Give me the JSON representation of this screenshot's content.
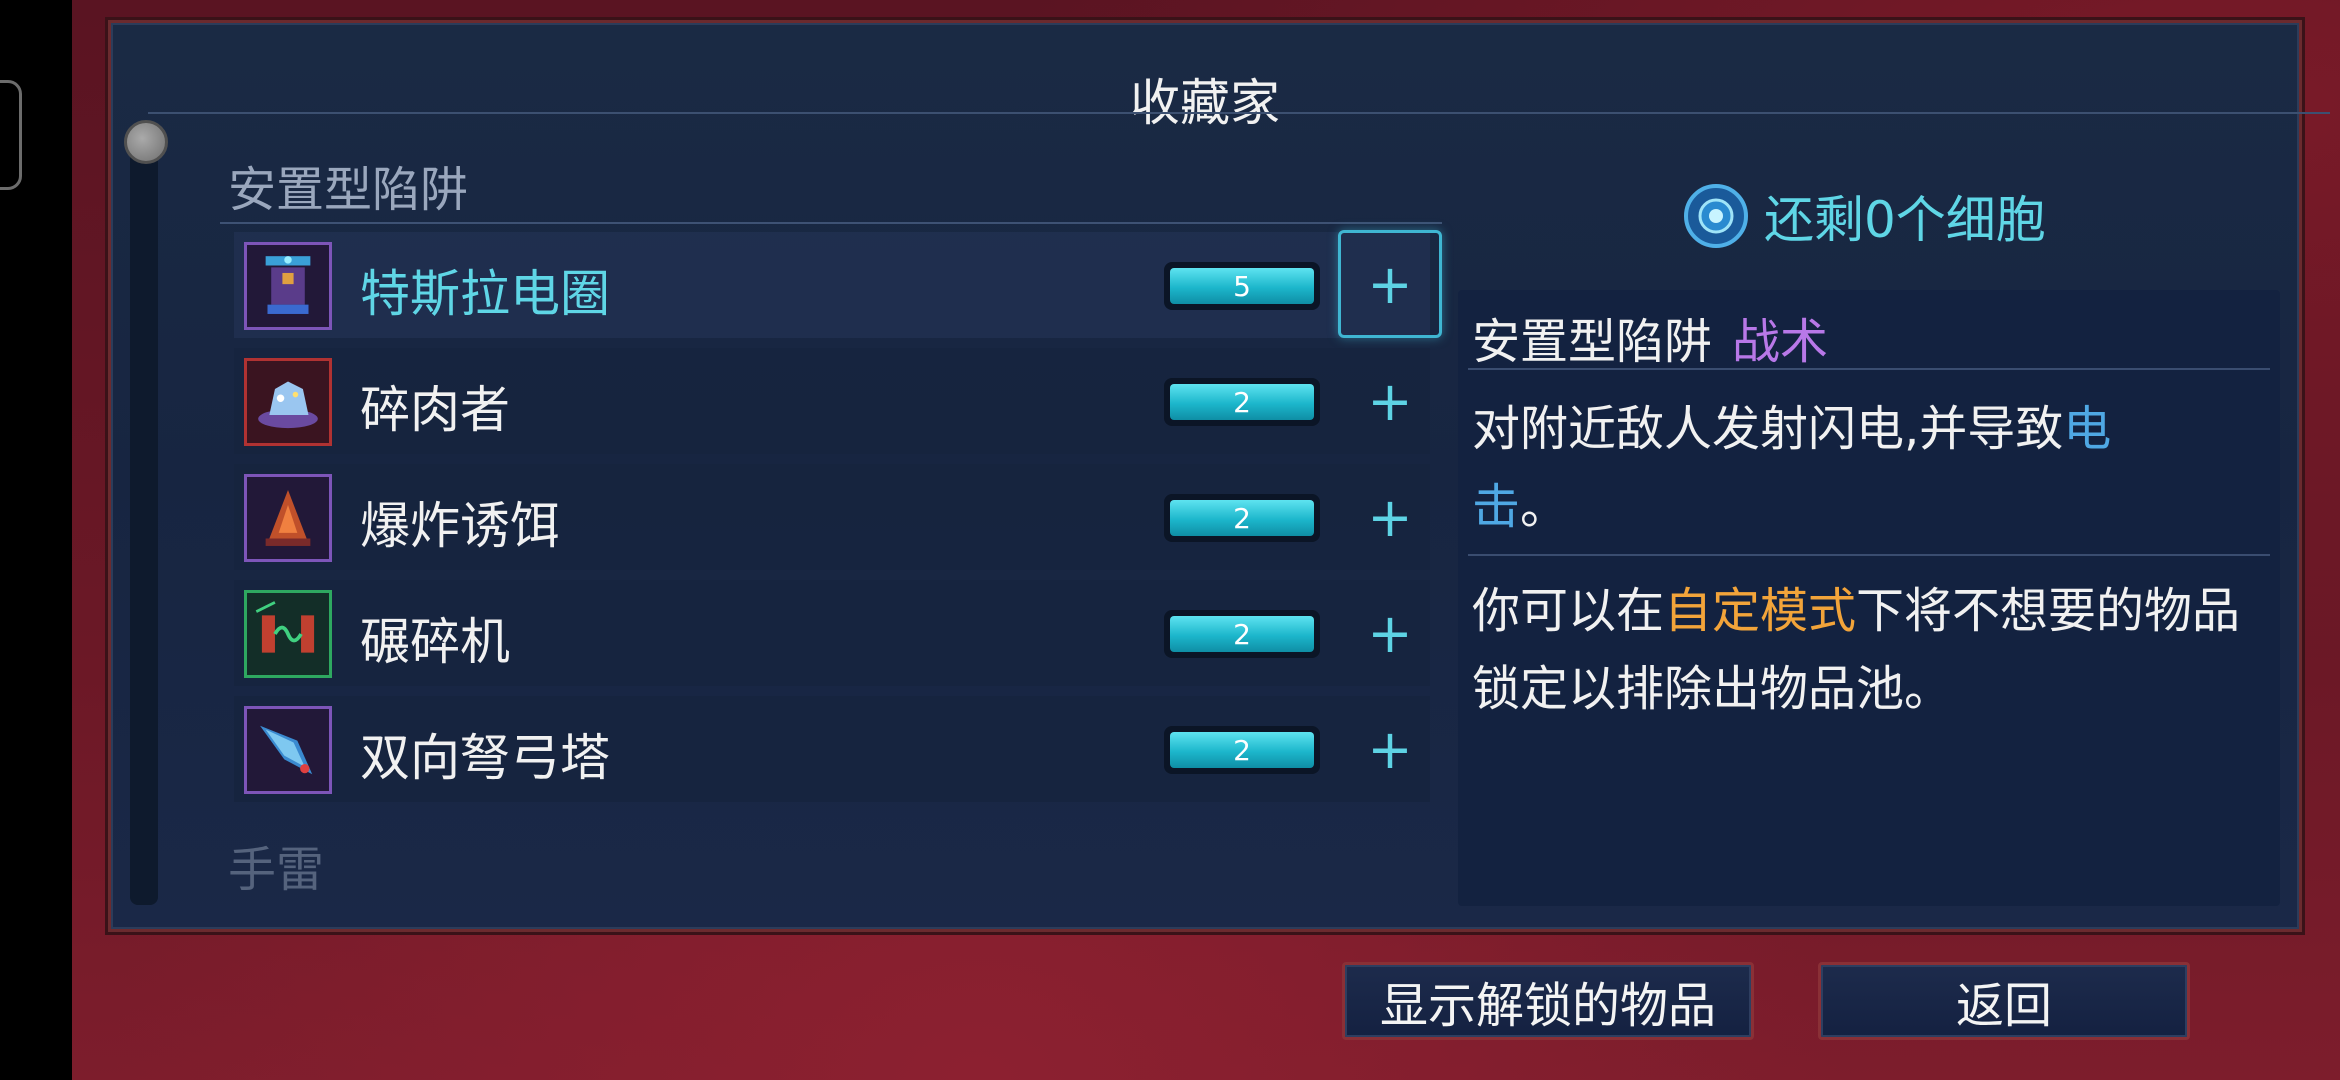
{
  "panel": {
    "title": "收藏家"
  },
  "sections": [
    {
      "header": "安置型陷阱"
    },
    {
      "header": "手雷"
    }
  ],
  "items": [
    {
      "name": "特斯拉电圈",
      "count": "5",
      "plus": "+",
      "selected": true
    },
    {
      "name": "碎肉者",
      "count": "2",
      "plus": "+",
      "selected": false
    },
    {
      "name": "爆炸诱饵",
      "count": "2",
      "plus": "+",
      "selected": false
    },
    {
      "name": "碾碎机",
      "count": "2",
      "plus": "+",
      "selected": false
    },
    {
      "name": "双向弩弓塔",
      "count": "2",
      "plus": "+",
      "selected": false
    }
  ],
  "cells": {
    "text": "还剩0个细胞",
    "icon": "cell-icon"
  },
  "detail": {
    "category": "安置型陷阱",
    "tag": "战术",
    "desc_part1": "对附近敌人发射闪电,并导致",
    "desc_highlight": "电击",
    "desc_part2": "。",
    "note_part1": "你可以在",
    "note_highlight": "自定模式",
    "note_part2": "下将不想要的物品锁定以排除出物品池。"
  },
  "buttons": {
    "show_unlocked": "显示解锁的物品",
    "back": "返回"
  },
  "colors": {
    "accent_cyan": "#5fd6e6",
    "tag_purple": "#b878e8",
    "highlight_blue": "#4fa8e4",
    "highlight_orange": "#f2a43a",
    "panel_bg": "#172541",
    "border_red": "#8a3036"
  }
}
